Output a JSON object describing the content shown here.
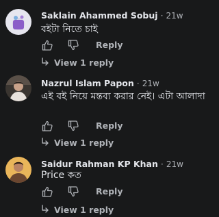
{
  "comments": [
    {
      "author": "Saklain Ahammed Sobuj",
      "separator": "·",
      "time": "21w",
      "text": "বইটা নিতে চাই",
      "like_icon": "thumbs-up-icon",
      "dislike_icon": "thumbs-down-icon",
      "reply_label": "Reply",
      "view_replies_label": "View 1 reply",
      "avatar_colors": {
        "bg": "#e6e6ef",
        "figure": "#8b5ec8"
      }
    },
    {
      "author": "Nazrul Islam Papon",
      "separator": "·",
      "time": "21w",
      "text": "এই বই নিয়ে মন্তব্য করার নেই। এটা আলাদা",
      "like_icon": "thumbs-up-icon",
      "dislike_icon": "thumbs-down-icon",
      "reply_label": "Reply",
      "view_replies_label": "View 1 reply",
      "avatar_colors": {
        "bg": "#3a3530",
        "figure": "#c9a28a"
      }
    },
    {
      "author": "Saidur Rahman KP Khan",
      "separator": "·",
      "time": "21w",
      "text": "Price কত",
      "like_icon": "thumbs-up-icon",
      "dislike_icon": "thumbs-down-icon",
      "reply_label": "Reply",
      "view_replies_label": "View 1 reply",
      "avatar_colors": {
        "bg": "#e9b55a",
        "figure": "#6b4630"
      }
    }
  ],
  "colors": {
    "background": "#18191a",
    "primary_text": "#e4e6eb",
    "secondary_text": "#b0b3b8"
  }
}
